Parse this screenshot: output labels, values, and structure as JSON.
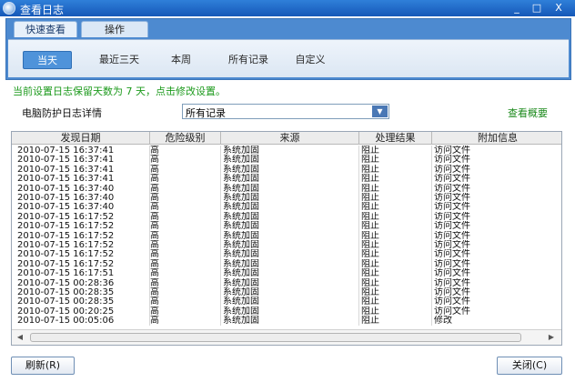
{
  "window": {
    "title": "查看日志",
    "minimize": "_",
    "maximize": "□",
    "close": "X"
  },
  "tabs": [
    {
      "label": "快速查看"
    },
    {
      "label": "操作"
    }
  ],
  "filters": [
    {
      "label": "当天"
    },
    {
      "label": "最近三天"
    },
    {
      "label": "本周"
    },
    {
      "label": "所有记录"
    },
    {
      "label": "自定义"
    }
  ],
  "note": "当前设置日志保留天数为 7 天，点击修改设置。",
  "detail": {
    "label": "电脑防护日志详情",
    "selected": "所有记录",
    "summary_link": "查看概要"
  },
  "table": {
    "headers": [
      "发现日期",
      "危险级别",
      "来源",
      "处理结果",
      "附加信息"
    ],
    "rows": [
      [
        "2010-07-15 16:37:41",
        "高",
        "系统加固",
        "阻止",
        "访问文件"
      ],
      [
        "2010-07-15 16:37:41",
        "高",
        "系统加固",
        "阻止",
        "访问文件"
      ],
      [
        "2010-07-15 16:37:41",
        "高",
        "系统加固",
        "阻止",
        "访问文件"
      ],
      [
        "2010-07-15 16:37:41",
        "高",
        "系统加固",
        "阻止",
        "访问文件"
      ],
      [
        "2010-07-15 16:37:40",
        "高",
        "系统加固",
        "阻止",
        "访问文件"
      ],
      [
        "2010-07-15 16:37:40",
        "高",
        "系统加固",
        "阻止",
        "访问文件"
      ],
      [
        "2010-07-15 16:37:40",
        "高",
        "系统加固",
        "阻止",
        "访问文件"
      ],
      [
        "2010-07-15 16:17:52",
        "高",
        "系统加固",
        "阻止",
        "访问文件"
      ],
      [
        "2010-07-15 16:17:52",
        "高",
        "系统加固",
        "阻止",
        "访问文件"
      ],
      [
        "2010-07-15 16:17:52",
        "高",
        "系统加固",
        "阻止",
        "访问文件"
      ],
      [
        "2010-07-15 16:17:52",
        "高",
        "系统加固",
        "阻止",
        "访问文件"
      ],
      [
        "2010-07-15 16:17:52",
        "高",
        "系统加固",
        "阻止",
        "访问文件"
      ],
      [
        "2010-07-15 16:17:52",
        "高",
        "系统加固",
        "阻止",
        "访问文件"
      ],
      [
        "2010-07-15 16:17:51",
        "高",
        "系统加固",
        "阻止",
        "访问文件"
      ],
      [
        "2010-07-15 00:28:36",
        "高",
        "系统加固",
        "阻止",
        "访问文件"
      ],
      [
        "2010-07-15 00:28:35",
        "高",
        "系统加固",
        "阻止",
        "访问文件"
      ],
      [
        "2010-07-15 00:28:35",
        "高",
        "系统加固",
        "阻止",
        "访问文件"
      ],
      [
        "2010-07-15 00:20:25",
        "高",
        "系统加固",
        "阻止",
        "访问文件"
      ],
      [
        "2010-07-15 00:05:06",
        "高",
        "系统加固",
        "阻止",
        "修改"
      ]
    ]
  },
  "buttons": {
    "refresh": "刷新(R)",
    "close": "关闭(C)"
  }
}
